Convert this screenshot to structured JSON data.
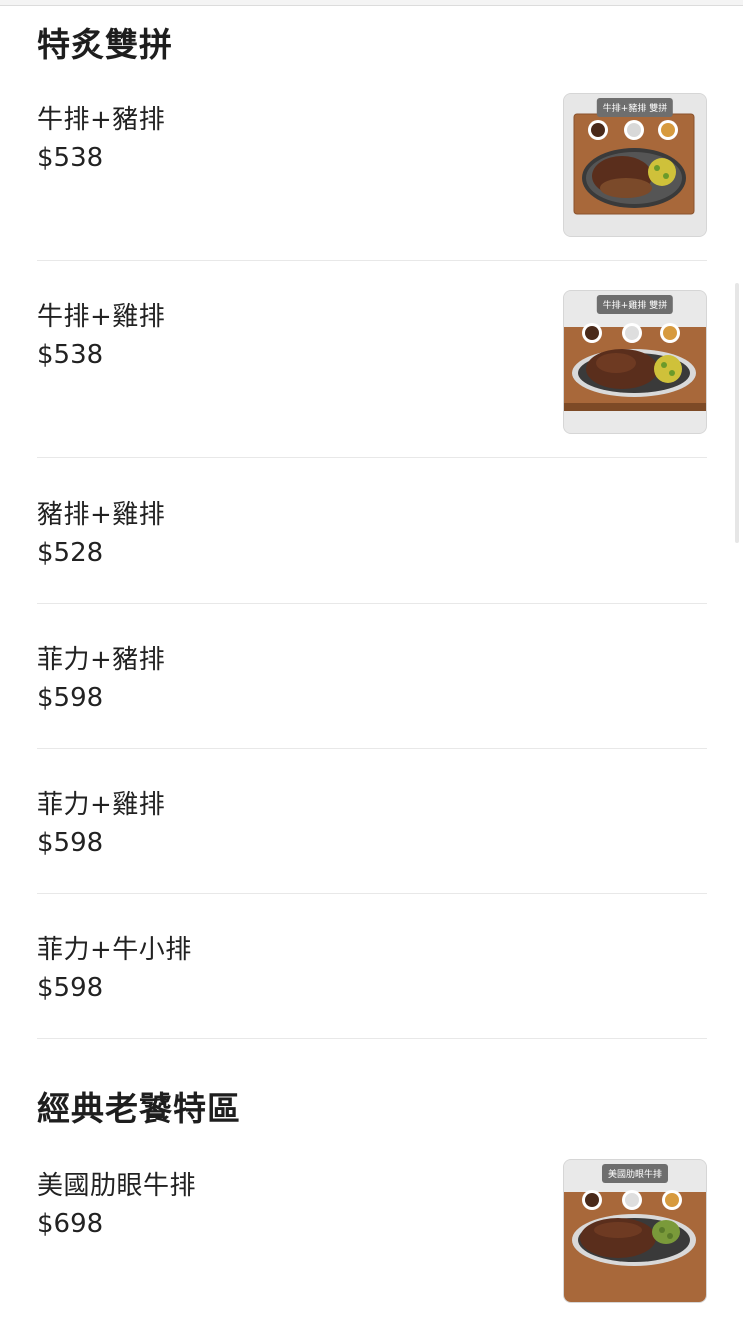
{
  "sections": [
    {
      "title": "特炙雙拼",
      "items": [
        {
          "name": "牛排+豬排",
          "price": "$538",
          "thumb_label": "牛排+豬排 雙拼"
        },
        {
          "name": "牛排+雞排",
          "price": "$538",
          "thumb_label": "牛排+雞排 雙拼"
        },
        {
          "name": "豬排+雞排",
          "price": "$528"
        },
        {
          "name": "菲力+豬排",
          "price": "$598"
        },
        {
          "name": "菲力+雞排",
          "price": "$598"
        },
        {
          "name": "菲力+牛小排",
          "price": "$598"
        }
      ]
    },
    {
      "title": "經典老饕特區",
      "items": [
        {
          "name": "美國肋眼牛排",
          "price": "$698",
          "thumb_label": "美國肋眼牛排"
        }
      ]
    }
  ],
  "colors": {
    "text": "#222222",
    "divider": "#e8e8e8",
    "board": "#a8683a",
    "plate": "#3a3a3a",
    "meat": "#5a2e1c"
  }
}
